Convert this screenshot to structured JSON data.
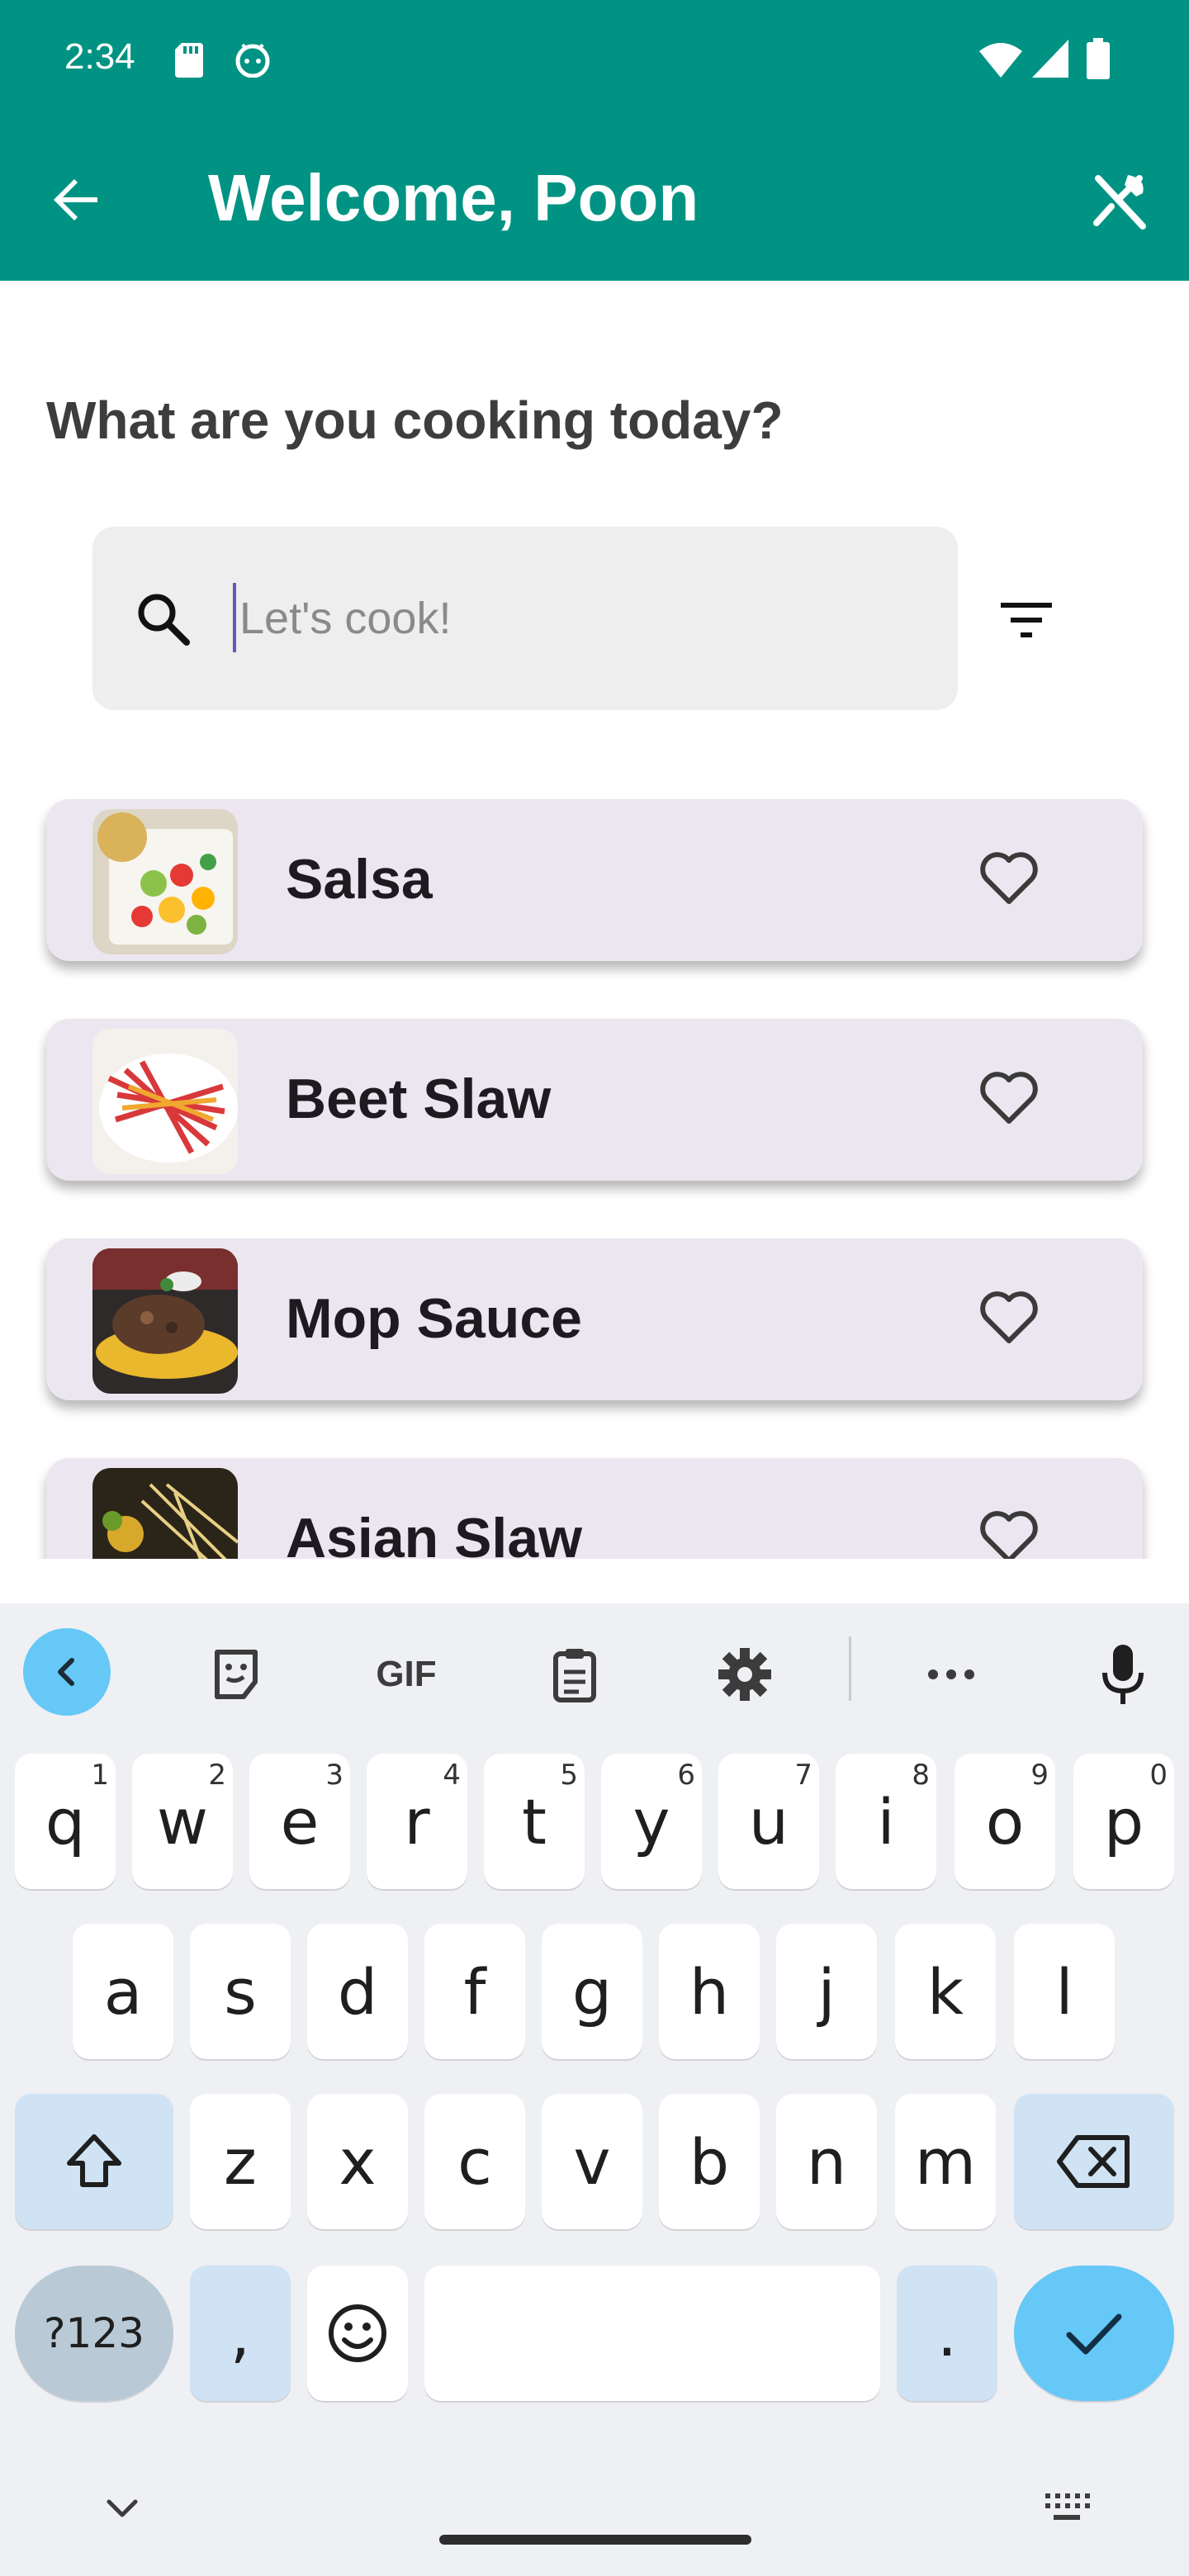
{
  "status_bar": {
    "time": "2:34"
  },
  "app_bar": {
    "title": "Welcome, Poon"
  },
  "main": {
    "heading": "What are you cooking today?",
    "search": {
      "placeholder": "Let's cook!",
      "value": ""
    }
  },
  "recipes": [
    {
      "name": "Salsa",
      "favorite": false
    },
    {
      "name": "Beet Slaw",
      "favorite": false
    },
    {
      "name": "Mop Sauce",
      "favorite": false
    },
    {
      "name": "Asian Slaw",
      "favorite": false
    }
  ],
  "keyboard": {
    "toolbar": {
      "gif_label": "GIF"
    },
    "row1": [
      {
        "key": "q",
        "hint": "1"
      },
      {
        "key": "w",
        "hint": "2"
      },
      {
        "key": "e",
        "hint": "3"
      },
      {
        "key": "r",
        "hint": "4"
      },
      {
        "key": "t",
        "hint": "5"
      },
      {
        "key": "y",
        "hint": "6"
      },
      {
        "key": "u",
        "hint": "7"
      },
      {
        "key": "i",
        "hint": "8"
      },
      {
        "key": "o",
        "hint": "9"
      },
      {
        "key": "p",
        "hint": "0"
      }
    ],
    "row2": [
      "a",
      "s",
      "d",
      "f",
      "g",
      "h",
      "j",
      "k",
      "l"
    ],
    "row3": [
      "z",
      "x",
      "c",
      "v",
      "b",
      "n",
      "m"
    ],
    "symbols_label": "?123",
    "comma": ",",
    "period": "."
  },
  "colors": {
    "app_bar": "#009383",
    "card_background": "#ece6f0",
    "search_background": "#eeeeee",
    "keyboard_accent": "#66c8f6"
  }
}
